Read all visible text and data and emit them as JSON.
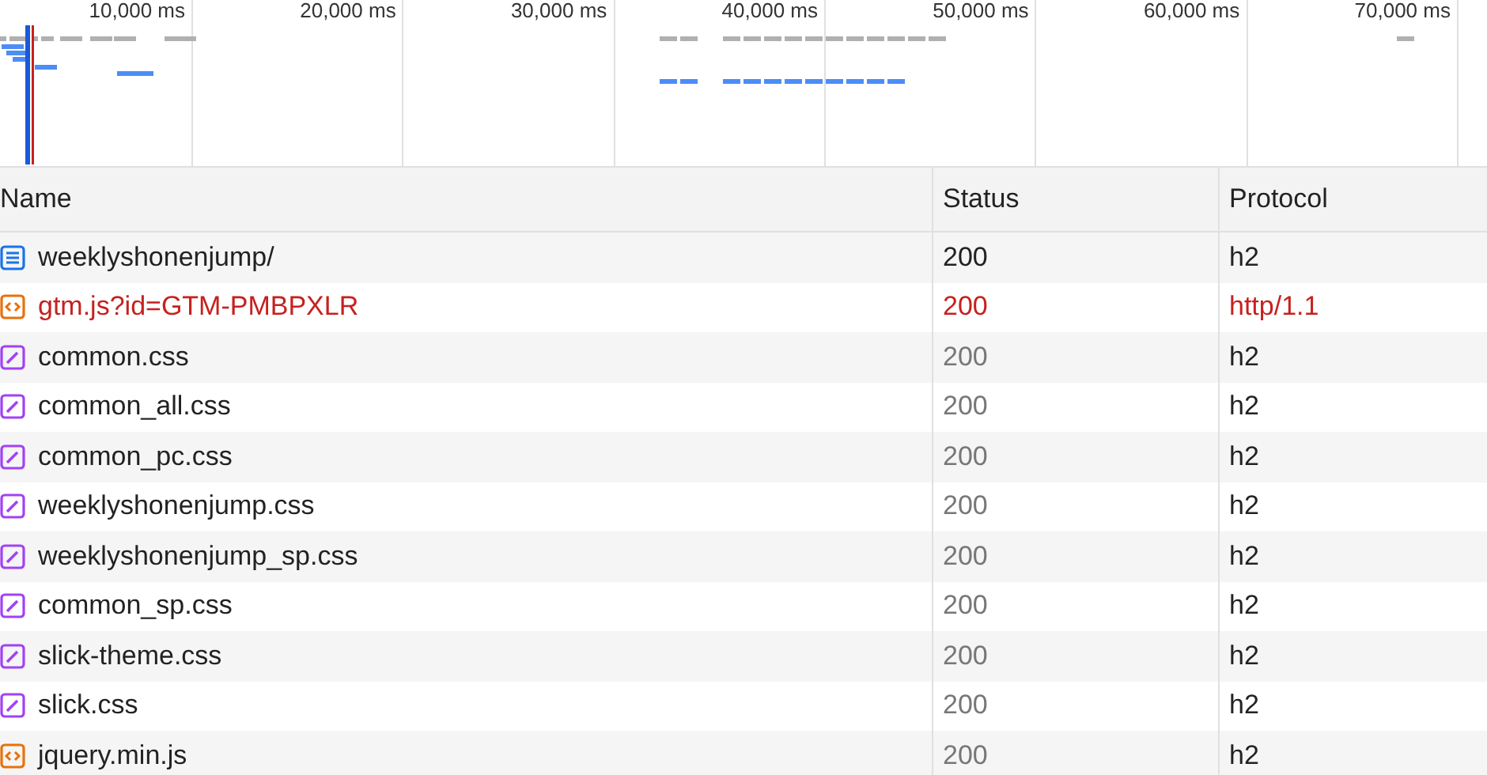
{
  "overview": {
    "ticks": [
      "10,000 ms",
      "20,000 ms",
      "30,000 ms",
      "40,000 ms",
      "50,000 ms",
      "60,000 ms",
      "70,000 ms"
    ]
  },
  "table": {
    "columns": [
      "Name",
      "Status",
      "Protocol"
    ],
    "rows": [
      {
        "kind": "document",
        "name": "weeklyshonenjump/",
        "status": "200",
        "protocol": "h2",
        "failed": false,
        "status_dimmed": false
      },
      {
        "kind": "script",
        "name": "gtm.js?id=GTM-PMBPXLR",
        "status": "200",
        "protocol": "http/1.1",
        "failed": true,
        "status_dimmed": false
      },
      {
        "kind": "stylesheet",
        "name": "common.css",
        "status": "200",
        "protocol": "h2",
        "failed": false,
        "status_dimmed": true
      },
      {
        "kind": "stylesheet",
        "name": "common_all.css",
        "status": "200",
        "protocol": "h2",
        "failed": false,
        "status_dimmed": true
      },
      {
        "kind": "stylesheet",
        "name": "common_pc.css",
        "status": "200",
        "protocol": "h2",
        "failed": false,
        "status_dimmed": true
      },
      {
        "kind": "stylesheet",
        "name": "weeklyshonenjump.css",
        "status": "200",
        "protocol": "h2",
        "failed": false,
        "status_dimmed": true
      },
      {
        "kind": "stylesheet",
        "name": "weeklyshonenjump_sp.css",
        "status": "200",
        "protocol": "h2",
        "failed": false,
        "status_dimmed": true
      },
      {
        "kind": "stylesheet",
        "name": "common_sp.css",
        "status": "200",
        "protocol": "h2",
        "failed": false,
        "status_dimmed": true
      },
      {
        "kind": "stylesheet",
        "name": "slick-theme.css",
        "status": "200",
        "protocol": "h2",
        "failed": false,
        "status_dimmed": true
      },
      {
        "kind": "stylesheet",
        "name": "slick.css",
        "status": "200",
        "protocol": "h2",
        "failed": false,
        "status_dimmed": true
      },
      {
        "kind": "script",
        "name": "jquery.min.js",
        "status": "200",
        "protocol": "h2",
        "failed": false,
        "status_dimmed": true
      }
    ]
  }
}
